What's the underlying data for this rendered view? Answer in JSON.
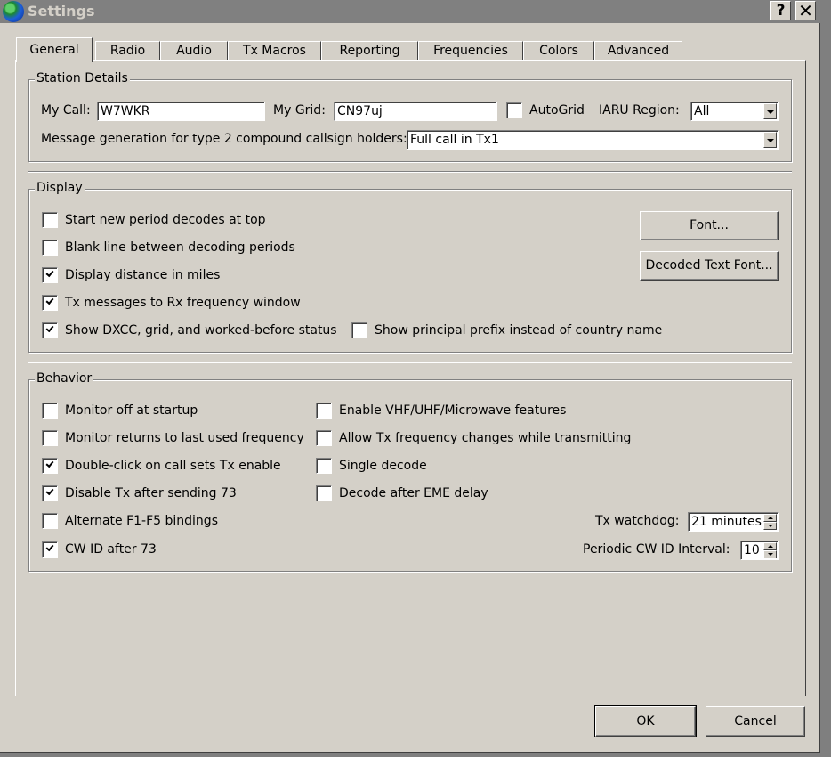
{
  "window": {
    "title": "Settings",
    "help_button": "?",
    "close_button": "✕"
  },
  "tabs": [
    {
      "label": "General",
      "active": true
    },
    {
      "label": "Radio",
      "active": false
    },
    {
      "label": "Audio",
      "active": false
    },
    {
      "label": "Tx Macros",
      "active": false
    },
    {
      "label": "Reporting",
      "active": false
    },
    {
      "label": "Frequencies",
      "active": false
    },
    {
      "label": "Colors",
      "active": false
    },
    {
      "label": "Advanced",
      "active": false
    }
  ],
  "station_details": {
    "title": "Station Details",
    "my_call_label": "My Call:",
    "my_call_value": "W7WKR",
    "my_grid_label": "My Grid:",
    "my_grid_value": "CN97uj",
    "autogrid_label": "AutoGrid",
    "autogrid_checked": false,
    "iaru_label": "IARU Region:",
    "iaru_value": "All",
    "msg_gen_label": "Message generation for type 2 compound callsign holders:",
    "msg_gen_value": "Full call in Tx1"
  },
  "display": {
    "title": "Display",
    "options": [
      {
        "label": "Start new period decodes at top",
        "checked": false
      },
      {
        "label": "Blank line between decoding periods",
        "checked": false
      },
      {
        "label": "Display distance in miles",
        "checked": true
      },
      {
        "label": "Tx messages to Rx frequency window",
        "checked": true
      },
      {
        "label": "Show DXCC, grid, and worked-before status",
        "checked": true
      },
      {
        "label": "Show principal prefix instead of country name",
        "checked": false
      }
    ],
    "font_button": "Font...",
    "decoded_font_button": "Decoded Text Font..."
  },
  "behavior": {
    "title": "Behavior",
    "left_options": [
      {
        "label": "Monitor off at startup",
        "checked": false
      },
      {
        "label": "Monitor returns to last used frequency",
        "checked": false
      },
      {
        "label": "Double-click on call sets Tx enable",
        "checked": true
      },
      {
        "label": "Disable Tx after sending 73",
        "checked": true
      },
      {
        "label": "Alternate F1-F5 bindings",
        "checked": false
      },
      {
        "label": "CW ID after 73",
        "checked": true
      }
    ],
    "right_options": [
      {
        "label": "Enable VHF/UHF/Microwave features",
        "checked": false
      },
      {
        "label": "Allow Tx frequency changes while transmitting",
        "checked": false
      },
      {
        "label": "Single decode",
        "checked": false
      },
      {
        "label": "Decode after EME delay",
        "checked": false
      }
    ],
    "tx_watchdog_label": "Tx watchdog:",
    "tx_watchdog_value": "21 minutes",
    "cw_interval_label": "Periodic CW ID Interval:",
    "cw_interval_value": "10"
  },
  "footer": {
    "ok_label": "OK",
    "cancel_label": "Cancel"
  }
}
